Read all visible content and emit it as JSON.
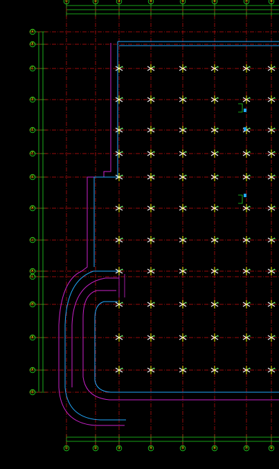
{
  "colors": {
    "background": "#000000",
    "axis_line": "#cc1111",
    "dimension_line": "#22dd22",
    "wall_outline": "#cc22cc",
    "inner_wall": "#22aaff",
    "column_mark": "#ffffff",
    "column_tick": "#ffff00",
    "bubble": "#22dd22",
    "bubble_text": "#ffff00"
  },
  "drawing": {
    "top_axis_labels": [
      "①",
      "②",
      "③",
      "④",
      "⑤",
      "⑥",
      "⑦",
      "⑧"
    ],
    "bottom_axis_labels": [
      "①",
      "②",
      "③",
      "④",
      "⑤",
      "⑥",
      "⑦",
      "⑧"
    ],
    "left_axis_labels": [
      "Ⓐ",
      "Ⓑ",
      "Ⓒ",
      "Ⓓ",
      "Ⓔ",
      "Ⓕ",
      "Ⓖ",
      "Ⓗ",
      "Ⓙ",
      "Ⓚ",
      "Ⓛ",
      "Ⓜ",
      "Ⓝ",
      "Ⓟ",
      "Ⓠ"
    ]
  }
}
